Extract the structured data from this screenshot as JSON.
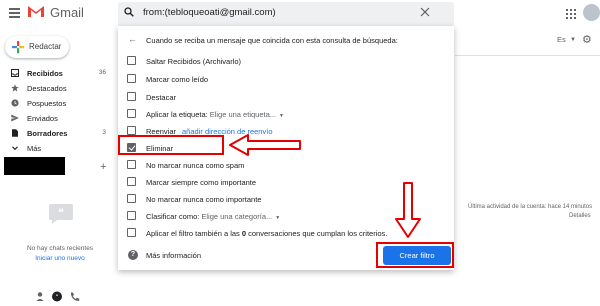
{
  "app": {
    "name": "Gmail"
  },
  "search": {
    "query": "from:(tebloqueoati@gmail.com)"
  },
  "sidebar": {
    "compose_label": "Redactar",
    "items": [
      {
        "label": "Recibidos",
        "count": "36",
        "bold": true,
        "icon": "inbox-icon"
      },
      {
        "label": "Destacados",
        "count": "",
        "bold": false,
        "icon": "star-icon"
      },
      {
        "label": "Pospuestos",
        "count": "",
        "bold": false,
        "icon": "clock-icon"
      },
      {
        "label": "Enviados",
        "count": "",
        "bold": false,
        "icon": "send-icon"
      },
      {
        "label": "Borradores",
        "count": "3",
        "bold": true,
        "icon": "draft-icon"
      },
      {
        "label": "Más",
        "count": "",
        "bold": false,
        "icon": "chevron-down-icon"
      }
    ],
    "add_label": "+",
    "chat_empty": "No hay chats recientes",
    "chat_link": "Iniciar uno nuevo"
  },
  "header_right": {
    "lang": "Es"
  },
  "activity": {
    "text": "Última actividad de la cuenta: hace 14 minutos",
    "details": "Detalles"
  },
  "filter": {
    "header": "Cuando se reciba un mensaje que coincida con esta consulta de búsqueda:",
    "options": [
      {
        "label": "Saltar Recibidos (Archivarlo)",
        "checked": false
      },
      {
        "label": "Marcar como leído",
        "checked": false
      },
      {
        "label": "Destacar",
        "checked": false
      },
      {
        "label": "Aplicar la etiqueta:",
        "select": "Elige una etiqueta...",
        "checked": false
      },
      {
        "label": "Reenviar",
        "link": "añadir dirección de reenvío",
        "checked": false
      },
      {
        "label": "Eliminar",
        "checked": true
      },
      {
        "label": "No marcar nunca como spam",
        "checked": false
      },
      {
        "label": "Marcar siempre como importante",
        "checked": false
      },
      {
        "label": "No marcar nunca como importante",
        "checked": false
      },
      {
        "label": "Clasificar como:",
        "select": "Elige una categoría...",
        "checked": false
      },
      {
        "label_pre": "Aplicar el filtro también a las ",
        "label_bold": "0",
        "label_post": " conversaciones que cumplan los criterios.",
        "checked": false
      }
    ],
    "help_label": "Más información",
    "create_button": "Crear filtro"
  },
  "colors": {
    "accent": "#1a73e8",
    "annotation": "#e60000",
    "gmail_red": "#ea4335"
  }
}
